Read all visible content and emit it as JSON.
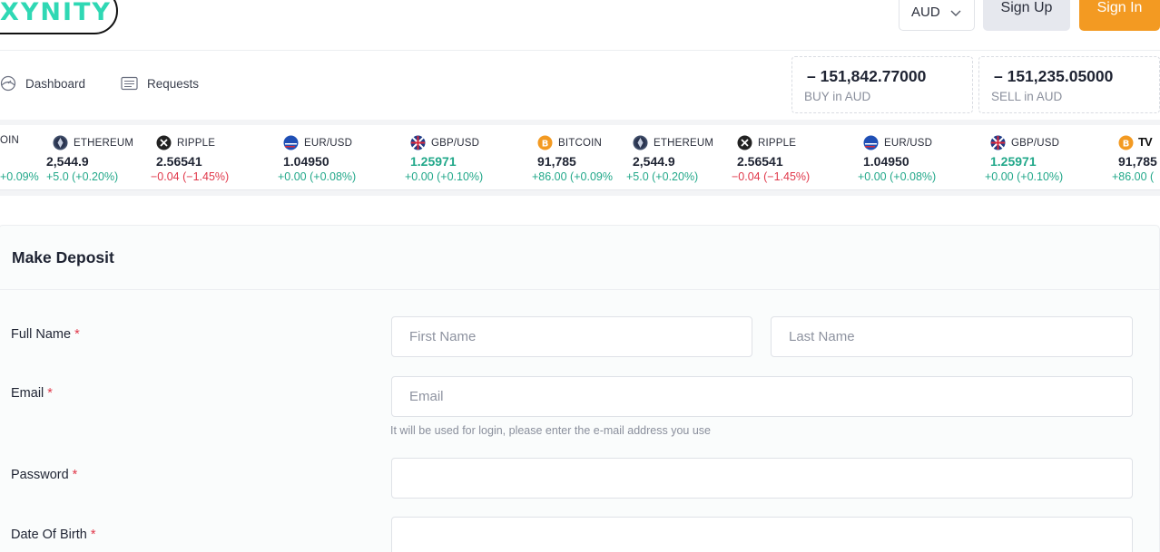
{
  "header": {
    "logo_text": "XYNITY",
    "currency": "AUD",
    "signup_label": "Sign Up",
    "signin_label": "Sign In"
  },
  "nav": {
    "dashboard_label": "Dashboard",
    "requests_label": "Requests"
  },
  "prices": {
    "buy_value": "–  151,842.77000",
    "buy_label": "BUY in AUD",
    "sell_value": "–  151,235.05000",
    "sell_label": "SELL in AUD"
  },
  "ticker": [
    {
      "name": "OIN",
      "price": "",
      "change": "+0.09%",
      "change_color": "green",
      "icon": "none"
    },
    {
      "name": "ETHEREUM",
      "price": "2,544.9",
      "change": "+5.0 (+0.20%)",
      "change_color": "green",
      "icon": "ethereum-icon"
    },
    {
      "name": "RIPPLE",
      "price": "2.56541",
      "change": "−0.04 (−1.45%)",
      "change_color": "red",
      "icon": "ripple-icon"
    },
    {
      "name": "EUR/USD",
      "price": "1.04950",
      "change": "+0.00 (+0.08%)",
      "change_color": "green",
      "icon": "eur-usd-flag-icon"
    },
    {
      "name": "GBP/USD",
      "price": "1.25971",
      "change": "+0.00 (+0.10%)",
      "change_color": "green",
      "price_color": "green",
      "icon": "gbp-usd-flag-icon"
    },
    {
      "name": "BITCOIN",
      "price": "91,785",
      "change": "+86.00 (+0.09%",
      "change_color": "green",
      "icon": "bitcoin-icon"
    },
    {
      "name": "ETHEREUM",
      "price": "2,544.9",
      "change": "+5.0 (+0.20%)",
      "change_color": "green",
      "icon": "ethereum-icon"
    },
    {
      "name": "RIPPLE",
      "price": "2.56541",
      "change": "−0.04 (−1.45%)",
      "change_color": "red",
      "icon": "ripple-icon"
    },
    {
      "name": "EUR/USD",
      "price": "1.04950",
      "change": "+0.00 (+0.08%)",
      "change_color": "green",
      "icon": "eur-usd-flag-icon"
    },
    {
      "name": "GBP/USD",
      "price": "1.25971",
      "change": "+0.00 (+0.10%)",
      "change_color": "green",
      "price_color": "green",
      "icon": "gbp-usd-flag-icon"
    },
    {
      "name": "",
      "price": "91,785",
      "change": "+86.00 (",
      "change_color": "green",
      "icon": "bitcoin-icon"
    }
  ],
  "tradingview_mark": "TV",
  "form": {
    "title": "Make Deposit",
    "full_name_label": "Full Name",
    "first_name_placeholder": "First Name",
    "last_name_placeholder": "Last Name",
    "email_label": "Email",
    "email_placeholder": "Email",
    "email_hint": "It will be used for login, please enter the e-mail address you use",
    "password_label": "Password",
    "dob_label": "Date Of Birth",
    "required_mark": "*"
  },
  "colors": {
    "accent_orange": "#f39a22",
    "logo_teal": "#2fd8b4",
    "positive": "#22a88a",
    "negative": "#e0384a"
  }
}
